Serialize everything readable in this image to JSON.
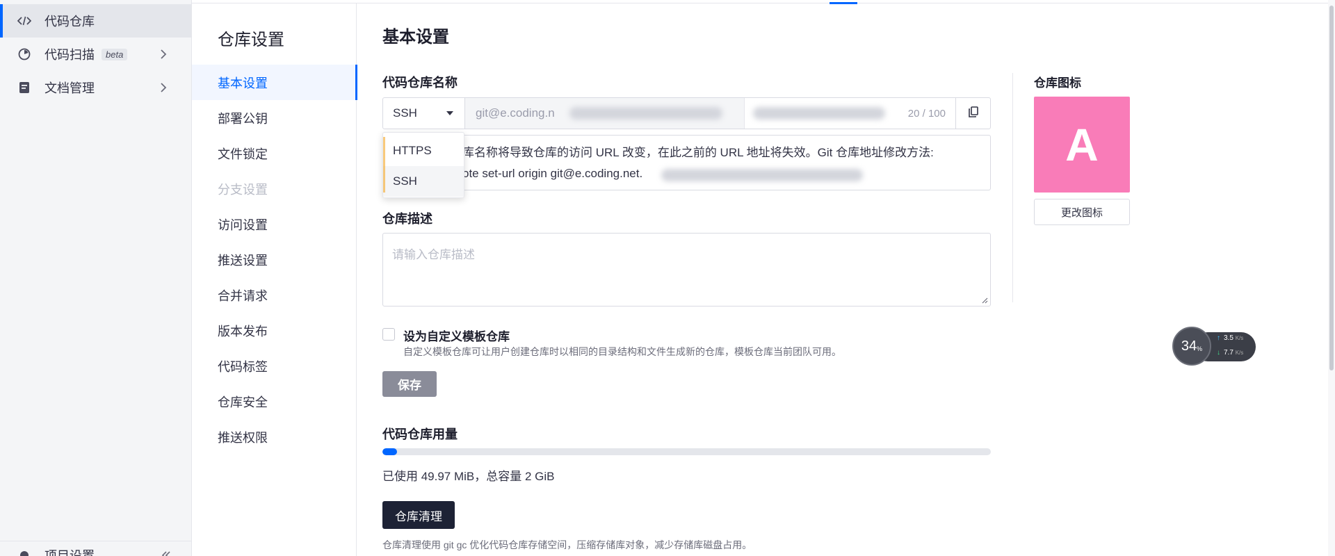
{
  "app_nav": {
    "items": [
      {
        "label": "代码仓库",
        "icon": "code-icon",
        "active": true
      },
      {
        "label": "代码扫描",
        "badge": "beta",
        "icon": "scan-icon",
        "active": false
      },
      {
        "label": "文档管理",
        "icon": "document-icon",
        "active": false
      }
    ],
    "bottom": {
      "label": "项目设置",
      "icon": "settings-icon"
    }
  },
  "settings_nav": {
    "title": "仓库设置",
    "items": [
      {
        "label": "基本设置",
        "state": "active"
      },
      {
        "label": "部署公钥",
        "state": "normal"
      },
      {
        "label": "文件锁定",
        "state": "normal"
      },
      {
        "label": "分支设置",
        "state": "disabled"
      },
      {
        "label": "访问设置",
        "state": "normal"
      },
      {
        "label": "推送设置",
        "state": "normal"
      },
      {
        "label": "合并请求",
        "state": "normal"
      },
      {
        "label": "版本发布",
        "state": "normal"
      },
      {
        "label": "代码标签",
        "state": "normal"
      },
      {
        "label": "仓库安全",
        "state": "normal"
      },
      {
        "label": "推送权限",
        "state": "normal"
      }
    ]
  },
  "main": {
    "title": "基本设置",
    "repo_name": {
      "label": "代码仓库名称",
      "protocol": "SSH",
      "url_prefix": "git@e.coding.n",
      "char_count": "20 / 100",
      "protocol_options": [
        "HTTPS",
        "SSH"
      ],
      "notice_line1": "库名称将导致仓库的访问 URL 改变，在此之前的 URL 地址将失效。Git 仓库地址修改方法:",
      "notice_line2": "ote set-url origin git@e.coding.net."
    },
    "description": {
      "label": "仓库描述",
      "placeholder": "请输入仓库描述"
    },
    "template": {
      "label": "设为自定义模板仓库",
      "help": "自定义模板仓库可让用户创建仓库时以相同的目录结构和文件生成新的仓库，模板仓库当前团队可用。",
      "checked": false
    },
    "save_label": "保存",
    "usage": {
      "label": "代码仓库用量",
      "text": "已使用 49.97 MiB，总容量 2 GiB",
      "fraction": 0.0244
    },
    "cleanup": {
      "button": "仓库清理",
      "help": "仓库清理使用 git gc 优化代码仓库存储空间，压缩存储库对象，减少存储库磁盘占用。"
    },
    "repo_icon": {
      "label": "仓库图标",
      "letter": "A",
      "color": "#f97cb8",
      "change_button": "更改图标"
    }
  },
  "net_widget": {
    "percent": "34",
    "percent_unit": "%",
    "up": "3.5",
    "down": "7.7",
    "unit": "K/s"
  },
  "colors": {
    "accent": "#0066ff",
    "dark_button": "#1d2235"
  }
}
